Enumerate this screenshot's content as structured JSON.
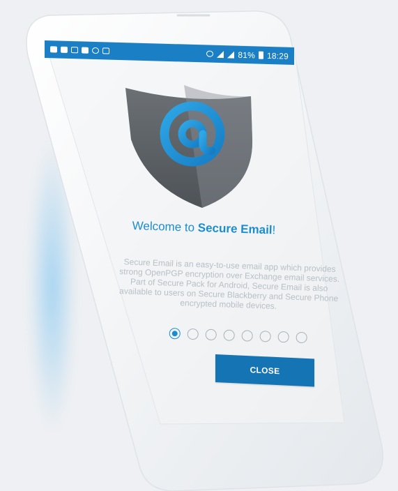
{
  "status_bar": {
    "battery": "81%",
    "time": "18:29"
  },
  "welcome": {
    "prefix": "Welcome to ",
    "app_name": "Secure Email",
    "suffix": "!"
  },
  "description": "Secure Email is an easy-to-use email app which provides strong OpenPGP encryption over Exchange email services. Part of Secure Pack for Android, Secure Email is also available to users on Secure Blackberry and Secure Phone encrypted mobile devices.",
  "pager": {
    "total": 8,
    "active": 1
  },
  "close_button": {
    "label": "CLOSE"
  },
  "colors": {
    "accent": "#1a8dd0",
    "status_bar": "#1a7fc4",
    "button": "#1574b4",
    "shield": "#5f6368"
  }
}
